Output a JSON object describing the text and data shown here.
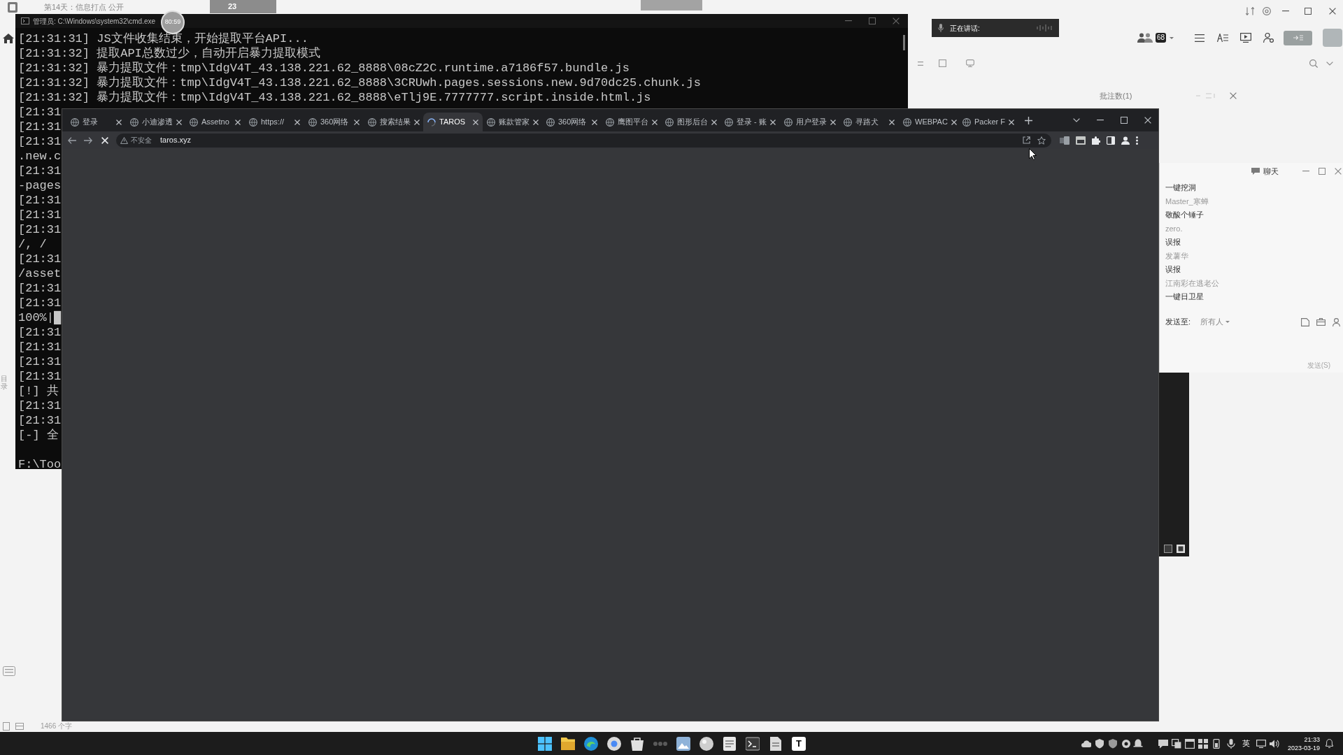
{
  "desktop_header": {
    "document_title": "第14天：信息打点 公开",
    "window_tab": "23"
  },
  "terminal": {
    "title": "管理员: C:\\Windows\\system32\\cmd.exe",
    "timer": "80:59",
    "lines": [
      "[21:31:31] JS文件收集结束，开始提取平台API...",
      "[21:31:32] 提取API总数过少，自动开启暴力提取模式",
      "[21:31:32] 暴力提取文件：tmp\\IdgV4T_43.138.221.62_8888\\08cZ2C.runtime.a7186f57.bundle.js",
      "[21:31:32] 暴力提取文件：tmp\\IdgV4T_43.138.221.62_8888\\3CRUwh.pages.sessions.new.9d70dc25.chunk.js",
      "[21:31:32] 暴力提取文件：tmp\\IdgV4T_43.138.221.62_8888\\eTlj9E.7777777.script.inside.html.js"
    ],
    "clipped_lines": [
      "[21:31",
      "[21:31",
      "[21:31",
      ".new.c",
      "[21:31",
      "-pages",
      "[21:31",
      "[21:31",
      "[21:31",
      "/, /",
      "[21:31",
      "/asset",
      "[21:31",
      "[21:31",
      "100%|█",
      "[21:31",
      "[21:31",
      "[21:31",
      "[21:31",
      "[!] 共",
      "[21:31",
      "[21:31",
      "[-] 全"
    ],
    "prompt": "F:\\Too"
  },
  "browser": {
    "loading": true,
    "tabs": [
      {
        "label": "登录",
        "selected": false,
        "loading": false
      },
      {
        "label": "小迪渗透",
        "selected": false,
        "loading": false
      },
      {
        "label": "Assetno",
        "selected": false,
        "loading": false
      },
      {
        "label": "https://",
        "selected": false,
        "loading": false
      },
      {
        "label": "360网络",
        "selected": false,
        "loading": false
      },
      {
        "label": "搜索结果",
        "selected": false,
        "loading": false
      },
      {
        "label": "TAROS",
        "selected": true,
        "loading": true
      },
      {
        "label": "账款管家",
        "selected": false,
        "loading": false
      },
      {
        "label": "360网络",
        "selected": false,
        "loading": false
      },
      {
        "label": "鹰图平台",
        "selected": false,
        "loading": false
      },
      {
        "label": "图形后台",
        "selected": false,
        "loading": false
      },
      {
        "label": "登录 - 账",
        "selected": false,
        "loading": false
      },
      {
        "label": "用户登录",
        "selected": false,
        "loading": false
      },
      {
        "label": "寻路犬",
        "selected": false,
        "loading": false
      },
      {
        "label": "WEBPAC",
        "selected": false,
        "loading": false
      },
      {
        "label": "Packer F",
        "selected": false,
        "loading": false
      }
    ],
    "security_label": "不安全",
    "url": "taros.xyz"
  },
  "meeting": {
    "speaking_label": "正在讲话:",
    "participant_count": "68",
    "annotation_count": "批注数(1)"
  },
  "chat": {
    "title": "聊天",
    "messages": [
      {
        "text": "一键挖洞"
      },
      {
        "sender": "Master_寒蝉",
        "text": "敬酸个锤子"
      },
      {
        "sender": "zero.",
        "text": "误报"
      },
      {
        "sender": "发薯华",
        "text": "误报"
      },
      {
        "sender": "江南彩在逃老公",
        "text": "一键日卫星"
      }
    ],
    "send_to_label": "发送至:",
    "recipient": "所有人",
    "send_button": "发送(S)"
  },
  "document_status": {
    "outline_label": "目录",
    "word_count": "1466 个字"
  },
  "taskbar": {
    "app_badge": "T",
    "input_method": "英",
    "time": "21:33",
    "date": "2023-03-19"
  }
}
